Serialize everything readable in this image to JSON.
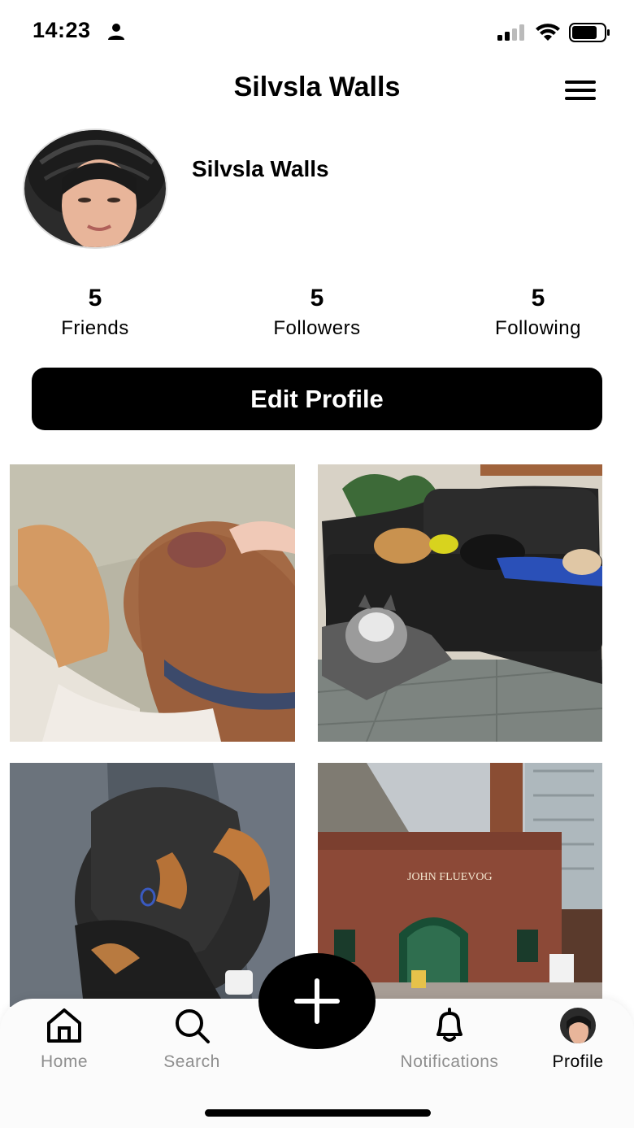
{
  "status_bar": {
    "time": "14:23"
  },
  "header": {
    "title": "Silvsla Walls"
  },
  "profile": {
    "name": "Silvsla Walls"
  },
  "stats": [
    {
      "count": "5",
      "label": "Friends"
    },
    {
      "count": "5",
      "label": "Followers"
    },
    {
      "count": "5",
      "label": "Following"
    }
  ],
  "edit_button": {
    "label": "Edit Profile"
  },
  "tabs": [
    {
      "label": "Home",
      "icon": "home-icon"
    },
    {
      "label": "Search",
      "icon": "search-icon"
    },
    {
      "label": "Notifications",
      "icon": "bell-icon"
    },
    {
      "label": "Profile",
      "icon": "avatar-icon"
    }
  ],
  "storefront_sign": "JOHN FLUEVOG",
  "colors": {
    "accent": "#000000",
    "inactive_tab": "#8e8e8e",
    "background": "#ffffff"
  }
}
